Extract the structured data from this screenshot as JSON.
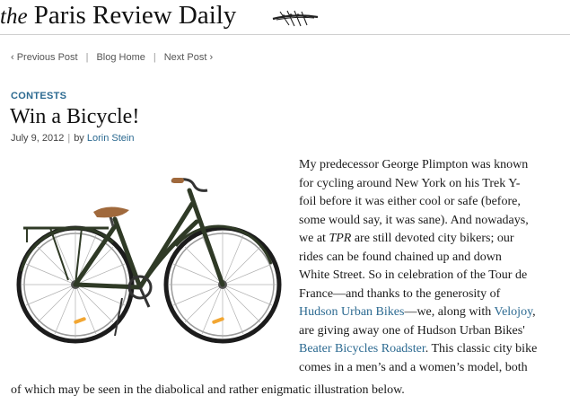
{
  "masthead": {
    "the": "the",
    "title": "Paris Review Daily"
  },
  "nav": {
    "previous": "‹ Previous Post",
    "home": "Blog Home",
    "next": "Next Post ›",
    "separator": "|"
  },
  "post": {
    "category": "CONTESTS",
    "title": "Win a Bicycle!",
    "date": "July 9, 2012",
    "by": "by",
    "author": "Lorin Stein"
  },
  "article": {
    "l1": "My predecessor George Plimpton was known",
    "l2": "for cycling around New York on his Trek Y-",
    "l3": "foil before it was either cool or safe (before,",
    "l4": "some would say, it was sane). And nowadays,",
    "l5a": "we at ",
    "l5b": "TPR",
    "l5c": " are still devoted city bikers; our",
    "l6": "rides can be found chained up and down",
    "l7": "White Street. So in celebration of the Tour de",
    "l8": "France—and thanks to the generosity of",
    "l9a": "Hudson Urban Bikes",
    "l9b": "—we, along with ",
    "l9c": "Velojoy",
    "l9d": ",",
    "l10": "are giving away one of Hudson Urban Bikes'",
    "l11a": "Beater Bicycles Roadster",
    "l11b": ". This classic city bike",
    "l12": "comes in a men’s and a women’s model, both",
    "l13": "of which may be seen in the diabolical and rather enigmatic illustration below."
  },
  "colors": {
    "link": "#2c6a91",
    "bike_frame": "#2f3a26",
    "saddle": "#a0693c"
  },
  "icons": {
    "logo": "rowing-shell-logo"
  }
}
